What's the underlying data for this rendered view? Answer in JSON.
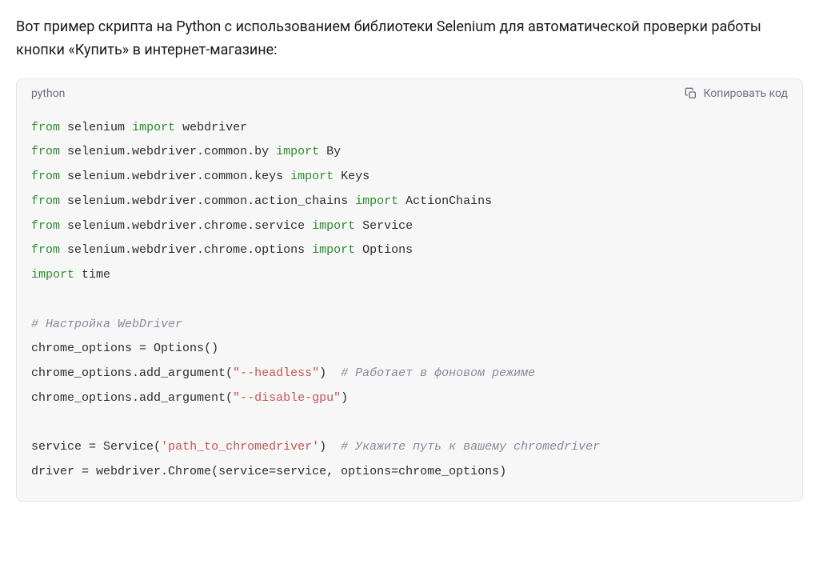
{
  "intro": "Вот пример скрипта на Python с использованием библиотеки Selenium для автоматической проверки работы кнопки «Купить» в интернет-магазине:",
  "code": {
    "language": "python",
    "copy_label": "Копировать код",
    "tokens": {
      "from": "from",
      "import": "import",
      "selenium": "selenium",
      "webdriver": "webdriver",
      "mod_by": "selenium.webdriver.common.by",
      "By": "By",
      "mod_keys": "selenium.webdriver.common.keys",
      "Keys": "Keys",
      "mod_ac": "selenium.webdriver.common.action_chains",
      "ActionChains": "ActionChains",
      "mod_service": "selenium.webdriver.chrome.service",
      "Service": "Service",
      "mod_options": "selenium.webdriver.chrome.options",
      "Options": "Options",
      "time": "time",
      "comment_setup": "# Настройка WebDriver",
      "chrome_options": "chrome_options",
      "eq": " = ",
      "Options_call": "Options",
      "paren_open": "(",
      "paren_close": ")",
      "add_argument": ".add_argument(",
      "headless_str": "\"--headless\"",
      "close_paren2": ")  ",
      "comment_bg": "# Работает в фоновом режиме",
      "disable_gpu_str": "\"--disable-gpu\"",
      "close_simple": ")",
      "service": "service",
      "Service_call": "Service",
      "path_str": "'path_to_chromedriver'",
      "close_paren3": ")  ",
      "comment_path": "# Укажите путь к вашему chromedriver",
      "driver": "driver",
      "webdriver_chrome": "webdriver.Chrome",
      "service_kw": "service",
      "eq2": "=",
      "service_val": "service",
      "comma": ", ",
      "options_kw": "options",
      "chrome_options_val": "chrome_options",
      "space": " "
    }
  }
}
